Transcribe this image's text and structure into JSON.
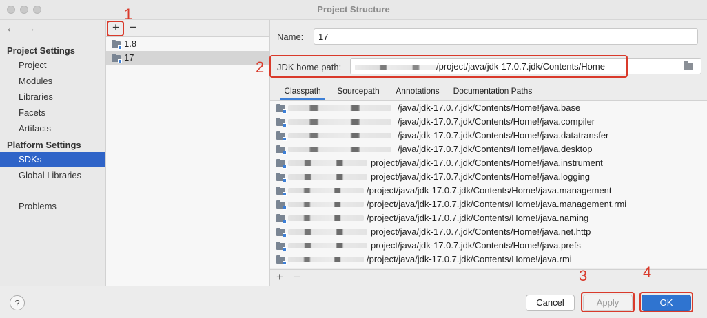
{
  "window": {
    "title": "Project Structure"
  },
  "nav": {
    "back_icon": "←",
    "forward_icon": "→",
    "project_settings_heading": "Project Settings",
    "project_items": [
      "Project",
      "Modules",
      "Libraries",
      "Facets",
      "Artifacts"
    ],
    "platform_settings_heading": "Platform Settings",
    "platform_items": [
      "SDKs",
      "Global Libraries"
    ],
    "selected_item": "SDKs",
    "problems": "Problems"
  },
  "sdk_list": {
    "add_icon": "+",
    "remove_icon": "−",
    "items": [
      "1.8",
      "17"
    ],
    "selected": "17"
  },
  "detail": {
    "name_label": "Name:",
    "name_value": "17",
    "jdk_home_label": "JDK home path:",
    "jdk_home_value": "/project/java/jdk-17.0.7.jdk/Contents/Home",
    "tabs": [
      "Classpath",
      "Sourcepath",
      "Annotations",
      "Documentation Paths"
    ],
    "active_tab": "Classpath",
    "classpath": [
      "/java/jdk-17.0.7.jdk/Contents/Home!/java.base",
      "/java/jdk-17.0.7.jdk/Contents/Home!/java.compiler",
      "/java/jdk-17.0.7.jdk/Contents/Home!/java.datatransfer",
      "/java/jdk-17.0.7.jdk/Contents/Home!/java.desktop",
      "project/java/jdk-17.0.7.jdk/Contents/Home!/java.instrument",
      "project/java/jdk-17.0.7.jdk/Contents/Home!/java.logging",
      "/project/java/jdk-17.0.7.jdk/Contents/Home!/java.management",
      "/project/java/jdk-17.0.7.jdk/Contents/Home!/java.management.rmi",
      "/project/java/jdk-17.0.7.jdk/Contents/Home!/java.naming",
      "project/java/jdk-17.0.7.jdk/Contents/Home!/java.net.http",
      "project/java/jdk-17.0.7.jdk/Contents/Home!/java.prefs",
      "/project/java/jdk-17.0.7.jdk/Contents/Home!/java.rmi"
    ],
    "add_path_icon": "+",
    "remove_path_icon": "−"
  },
  "footer": {
    "help_label": "?",
    "cancel_label": "Cancel",
    "apply_label": "Apply",
    "ok_label": "OK"
  },
  "annotations": {
    "one": "1",
    "two": "2",
    "three": "3",
    "four": "4"
  },
  "colors": {
    "accent": "#2f74d0",
    "selection": "#2f64c8",
    "annotation_red": "#d93a2b"
  }
}
